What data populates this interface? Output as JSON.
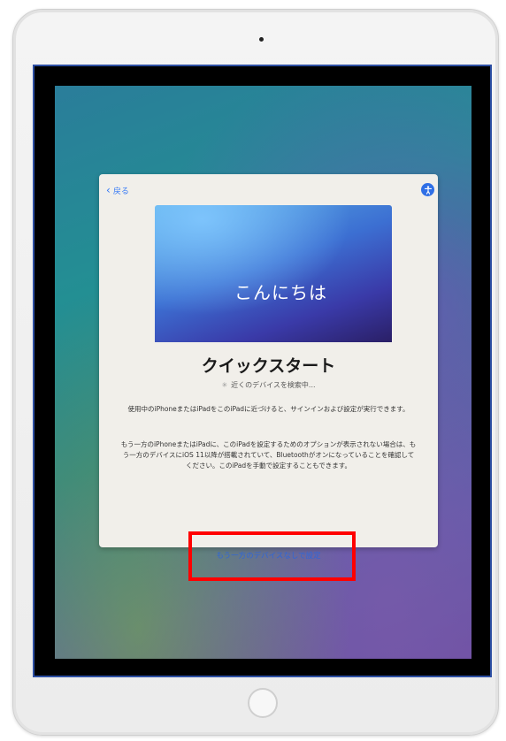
{
  "device": {
    "camera_icon": "camera-dot",
    "home_button_icon": "home-button-circle"
  },
  "setup": {
    "back_label": "戻る",
    "back_icon": "chevron-left-icon",
    "accessibility_icon": "accessibility-icon",
    "hero_text": "こんにちは",
    "title": "クイックスタート",
    "searching_text": "近くのデバイスを検索中...",
    "paragraph1": "使用中のiPhoneまたはiPadをこのiPadに近づけると、サインインおよび設定が実行できます。",
    "paragraph2": "もう一方のiPhoneまたはiPadに、このiPadを設定するためのオプションが表示されない場合は、もう一方のデバイスにiOS 11以降が搭載されていて、Bluetoothがオンになっていることを確認してください。このiPadを手動で設定することもできます。",
    "bottom_link": "もう一方のデバイスなしで設定"
  },
  "colors": {
    "accent_blue": "#2f66d8",
    "highlight_red": "#ff0000",
    "frame_blue": "#2d4fa3"
  },
  "app_icons": [
    "#e0534a",
    "#f2d4c4",
    "#2bb08a",
    "#f1c0c8",
    "#3f7fe0",
    "#1f9bd7",
    "#2aa86a",
    "#c23a8f",
    "#6b5bd6",
    "#f2b632",
    "#f5d74a",
    "#5a3fc6"
  ]
}
